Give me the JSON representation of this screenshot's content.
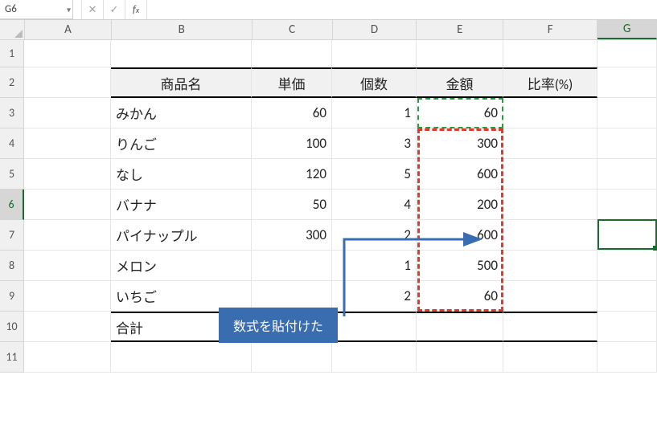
{
  "name_box": "G6",
  "formula": "",
  "columns": [
    "A",
    "B",
    "C",
    "D",
    "E",
    "F",
    "G"
  ],
  "rows": [
    "1",
    "2",
    "3",
    "4",
    "5",
    "6",
    "7",
    "8",
    "9",
    "10",
    "11"
  ],
  "active_col": "G",
  "active_row": "6",
  "headers": {
    "name": "商品名",
    "price": "単価",
    "qty": "個数",
    "amount": "金額",
    "ratio": "比率(%)"
  },
  "items": [
    {
      "name": "みかん",
      "price": 60,
      "qty": 1,
      "amount": 60
    },
    {
      "name": "りんご",
      "price": 100,
      "qty": 3,
      "amount": 300
    },
    {
      "name": "なし",
      "price": 120,
      "qty": 5,
      "amount": 600
    },
    {
      "name": "バナナ",
      "price": 50,
      "qty": 4,
      "amount": 200
    },
    {
      "name": "パイナップル",
      "price": 300,
      "qty": 2,
      "amount": 600
    },
    {
      "name": "メロン",
      "price": "",
      "qty": 1,
      "amount": 500
    },
    {
      "name": "いちご",
      "price": "",
      "qty": 2,
      "amount": 60
    }
  ],
  "total_label": "合計",
  "callout_text": "数式を貼付けた",
  "chart_data": {
    "type": "table",
    "columns": [
      "商品名",
      "単価",
      "個数",
      "金額",
      "比率(%)"
    ],
    "rows": [
      [
        "みかん",
        60,
        1,
        60,
        null
      ],
      [
        "りんご",
        100,
        3,
        300,
        null
      ],
      [
        "なし",
        120,
        5,
        600,
        null
      ],
      [
        "バナナ",
        50,
        4,
        200,
        null
      ],
      [
        "パイナップル",
        300,
        2,
        600,
        null
      ],
      [
        "メロン",
        null,
        1,
        500,
        null
      ],
      [
        "いちご",
        null,
        2,
        60,
        null
      ],
      [
        "合計",
        null,
        null,
        null,
        null
      ]
    ]
  }
}
